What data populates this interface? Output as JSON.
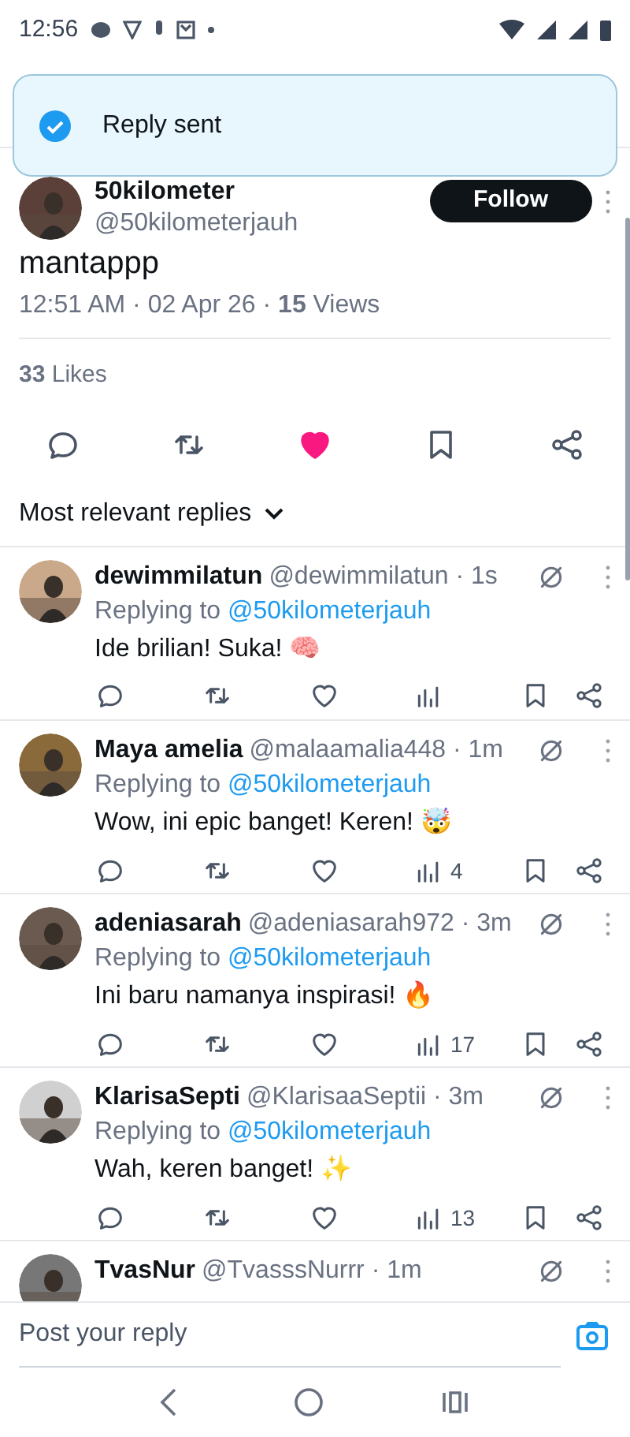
{
  "status_bar": {
    "time": "12:56"
  },
  "toast": {
    "text": "Reply sent"
  },
  "tweet": {
    "author": {
      "name": "50kilometer",
      "handle": "@50kilometerjauh"
    },
    "follow_button": "Follow",
    "text": "mantappp",
    "meta": "12:51 AM · 02 Apr 26 · **15** Views",
    "likes": "**33** Likes",
    "liked": true,
    "bookmarked": false
  },
  "sort": {
    "label": "Most relevant replies"
  },
  "replies": [
    {
      "name": "dewimmilatun",
      "meta": "@dewimmilatun · 1s",
      "replying_label": "Replying to",
      "replying_to": "@50kilometerjauh",
      "text": "Ide brilian! Suka! 🧠"
    },
    {
      "name": "Maya amelia",
      "meta": "@malaamalia448 · 1m",
      "replying_label": "Replying to",
      "replying_to": "@50kilometerjauh",
      "text": "Wow, ini epic banget! Keren! 🤯",
      "views": "4"
    },
    {
      "name": "adeniasarah",
      "meta": "@adeniasarah972 · 3m",
      "replying_label": "Replying to",
      "replying_to": "@50kilometerjauh",
      "text": "Ini baru namanya inspirasi! 🔥",
      "views": "17"
    },
    {
      "name": "KlarisaSepti",
      "meta": "@KlarisaaSeptii · 3m",
      "replying_label": "Replying to",
      "replying_to": "@50kilometerjauh",
      "text": "Wah, keren banget! ✨",
      "views": "13"
    },
    {
      "name": "TvasNur",
      "meta": "@TvasssNurrr · 1m"
    }
  ],
  "reply_bar": {
    "placeholder": "Post your reply"
  }
}
